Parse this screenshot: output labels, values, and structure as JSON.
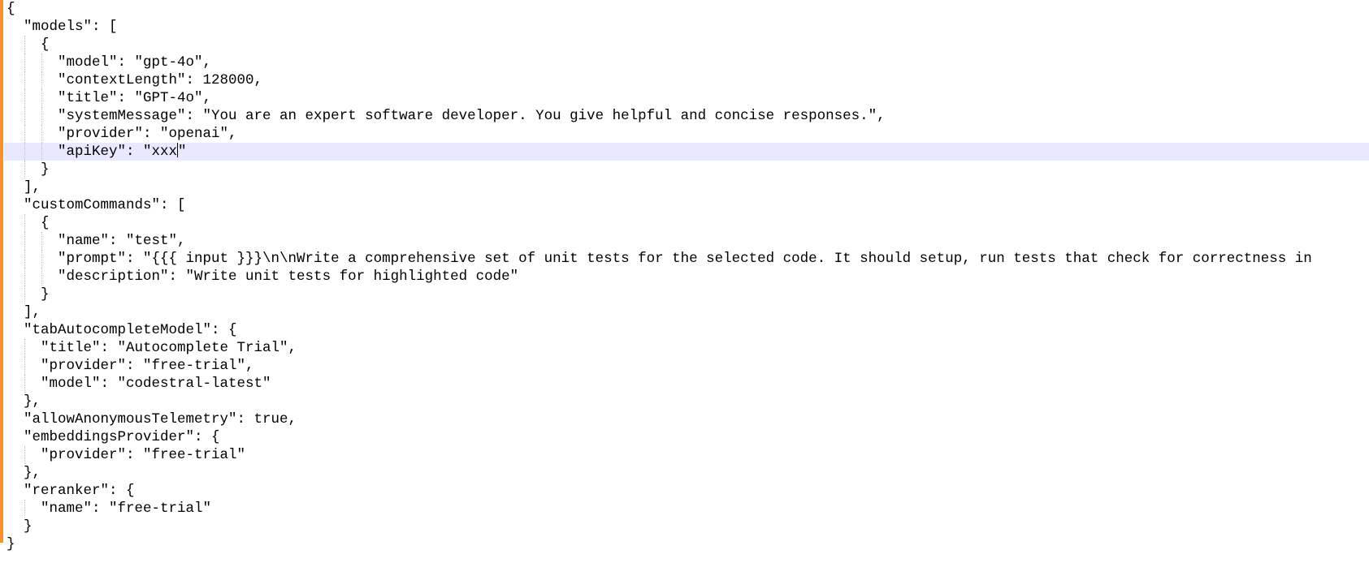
{
  "editor": {
    "lines": [
      "{",
      "  \"models\": [",
      "    {",
      "      \"model\": \"gpt-4o\",",
      "      \"contextLength\": 128000,",
      "      \"title\": \"GPT-4o\",",
      "      \"systemMessage\": \"You are an expert software developer. You give helpful and concise responses.\",",
      "      \"provider\": \"openai\",",
      "      \"apiKey\": \"xxx",
      "    }",
      "  ],",
      "  \"customCommands\": [",
      "    {",
      "      \"name\": \"test\",",
      "      \"prompt\": \"{{{ input }}}\\n\\nWrite a comprehensive set of unit tests for the selected code. It should setup, run tests that check for correctness in",
      "      \"description\": \"Write unit tests for highlighted code\"",
      "    }",
      "  ],",
      "  \"tabAutocompleteModel\": {",
      "    \"title\": \"Autocomplete Trial\",",
      "    \"provider\": \"free-trial\",",
      "    \"model\": \"codestral-latest\"",
      "  },",
      "  \"allowAnonymousTelemetry\": true,",
      "  \"embeddingsProvider\": {",
      "    \"provider\": \"free-trial\"",
      "  },",
      "  \"reranker\": {",
      "    \"name\": \"free-trial\"",
      "  }",
      "}"
    ],
    "cursor_line_after_caret": "\"",
    "current_line_number": 9,
    "change_bar_color": "#f5922f",
    "current_line_color": "#e8e8ff"
  }
}
